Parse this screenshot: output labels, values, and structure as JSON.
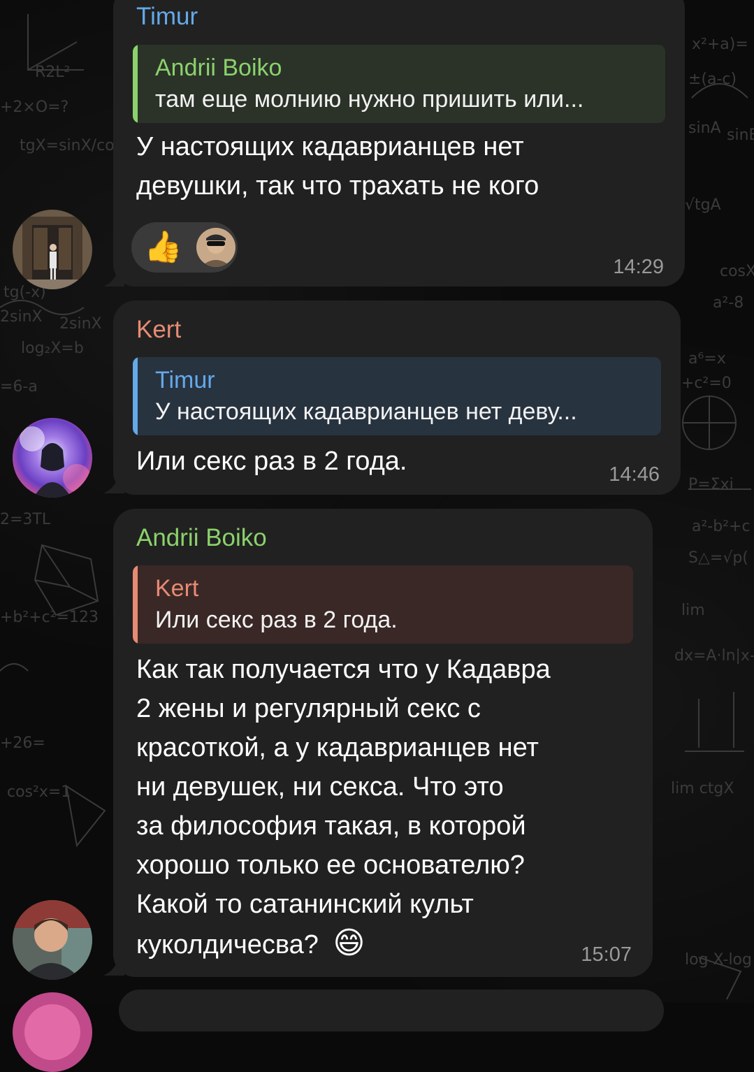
{
  "colors": {
    "bubble": "#212121",
    "timur": "#64a9e9",
    "andrii": "#8bd26c",
    "kert": "#e88b74",
    "time": "#9a9a9a",
    "reply_blue_bg": "#283340",
    "reply_green_bg": "#2b3329",
    "reply_red_bg": "#3a2826"
  },
  "messages": [
    {
      "sender": "Timur",
      "reply": {
        "name": "Andrii Boiko",
        "text": "там еще молнию нужно пришить или..."
      },
      "lines": [
        "У настоящих кадаврианцев нет",
        "девушки, так что трахать не кого"
      ],
      "reactions": {
        "emoji": "👍",
        "avatar_icon": "user-avatar-icon"
      },
      "time": "14:29"
    },
    {
      "sender": "Kert",
      "reply": {
        "name": "Timur",
        "text": "У настоящих кадаврианцев нет деву..."
      },
      "lines": [
        "Или секс раз в 2 года."
      ],
      "time": "14:46"
    },
    {
      "sender": "Andrii Boiko",
      "reply": {
        "name": "Kert",
        "text": "Или секс раз в 2 года."
      },
      "lines": [
        "Как так получается что у Кадавра",
        "2 жены и регулярный секс с",
        "красоткой, а у кадаврианцев нет",
        "ни девушек, ни секса. Что это",
        "за философия такая, в которой",
        "хорошо только ее основателю?",
        "Какой то сатанинский культ",
        "куколдичесва?"
      ],
      "trailing_emoji": "😄",
      "time": "15:07"
    }
  ]
}
